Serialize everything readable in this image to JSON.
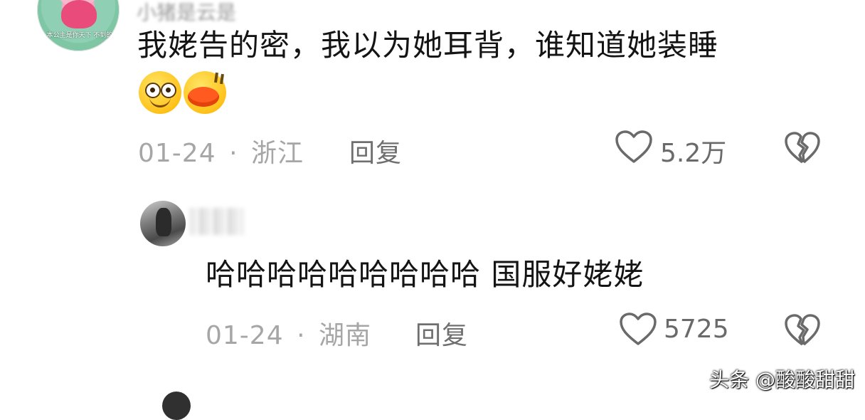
{
  "comments": [
    {
      "username": "小猪是云是",
      "avatar_caption": "本公主是你天下 不到的",
      "text": "我姥告的密，我以为她耳背，谁知道她装睡",
      "emojis": [
        "smiling-face-emoji",
        "duck-lips-emoji"
      ],
      "date": "01-24",
      "separator": "·",
      "location": "浙江",
      "reply_label": "回复",
      "likes": "5.2万"
    },
    {
      "username": "",
      "text": "哈哈哈哈哈哈哈哈哈  国服好姥姥",
      "date": "01-24",
      "separator": "·",
      "location": "湖南",
      "reply_label": "回复",
      "likes": "5725"
    }
  ],
  "icons": {
    "like": "heart-outline-icon",
    "dislike": "broken-heart-icon"
  },
  "watermark": "头条 @酸酸甜甜",
  "colors": {
    "text": "#141414",
    "meta": "#a6a6a6",
    "icon": "#6a6a6a",
    "background": "#ffffff"
  }
}
